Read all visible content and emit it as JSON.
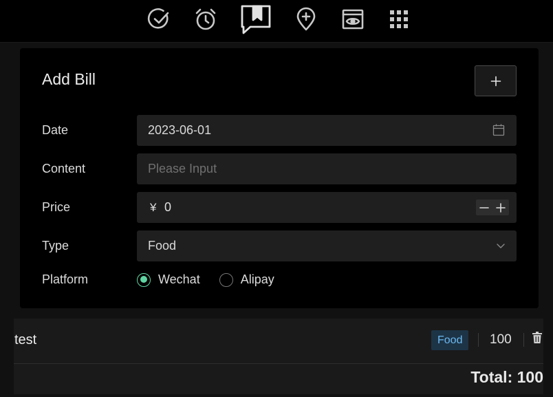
{
  "toolbar": {
    "icons": [
      "check-circle-icon",
      "alarm-clock-icon",
      "chat-bookmark-icon",
      "map-pin-plus-icon",
      "browser-eye-icon",
      "grid-apps-icon"
    ],
    "active_icon": "chat-bookmark-icon"
  },
  "form": {
    "title": "Add Bill",
    "add_button_label": "+",
    "date": {
      "label": "Date",
      "value": "2023-06-01"
    },
    "content": {
      "label": "Content",
      "placeholder": "Please Input"
    },
    "price": {
      "label": "Price",
      "prefix": "¥",
      "value": "0",
      "decrement": "−",
      "increment": "+"
    },
    "type": {
      "label": "Type",
      "value": "Food"
    },
    "platform": {
      "label": "Platform",
      "options": [
        "Wechat",
        "Alipay"
      ],
      "selected": "Wechat"
    }
  },
  "bills": [
    {
      "title": "test",
      "tag": "Food",
      "amount": "100"
    }
  ],
  "total_text": "Total: 100",
  "colors": {
    "accent": "#5fd5a4",
    "tag_bg": "#1d3447",
    "tag_text": "#6bb8f0",
    "background": "#111111",
    "card": "#000000",
    "field": "#1f1f1f"
  }
}
